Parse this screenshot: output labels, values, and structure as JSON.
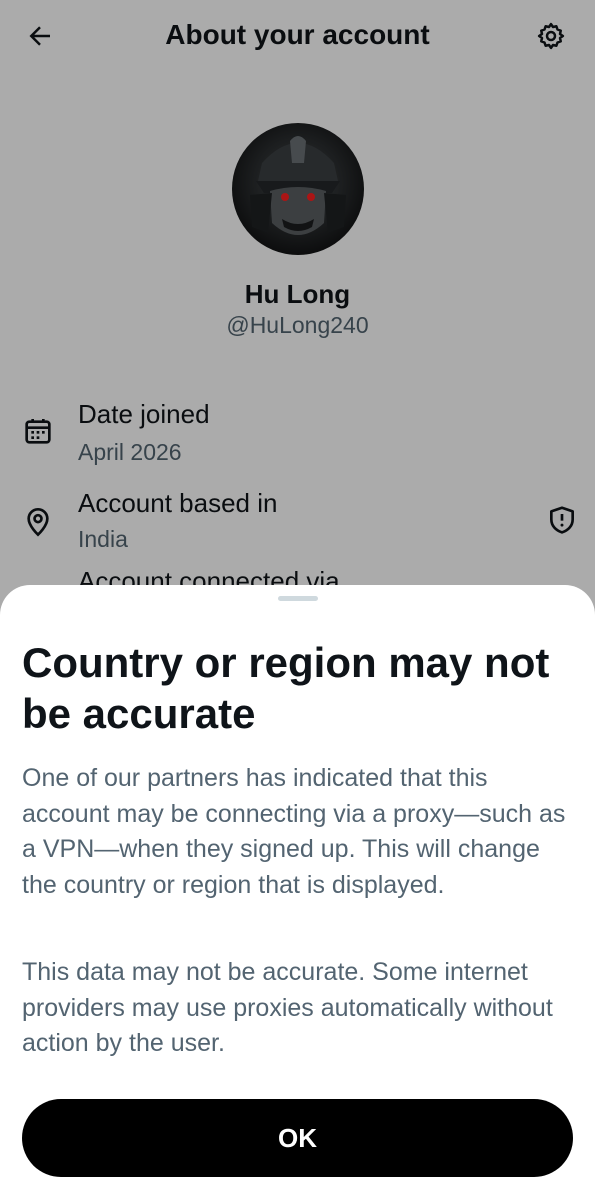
{
  "header": {
    "title": "About your account",
    "back_icon": "arrow-left-icon",
    "settings_icon": "gear-icon"
  },
  "profile": {
    "name": "Hu Long",
    "handle": "@HuLong240",
    "avatar": "samurai-helmet-avatar"
  },
  "info_rows": [
    {
      "label": "Date joined",
      "value": "April 2026",
      "icon": "calendar-icon"
    },
    {
      "label": "Account based in",
      "value": "India",
      "icon": "location-pin-icon",
      "trailing_icon": "shield-alert-icon"
    }
  ],
  "info_row_partial": "Account connected via",
  "sheet": {
    "title": "Country or region may not be accurate",
    "paragraphs": [
      "One of our partners has indicated that this account may be connecting via a proxy—such as a VPN—when they signed up. This will change the country or region that is displayed.",
      "This data may not be accurate. Some internet providers may use proxies automatically without action by the user."
    ],
    "ok_label": "OK"
  },
  "colors": {
    "text_primary": "#0f1419",
    "text_secondary": "#536471",
    "overlay": "rgba(0,0,0,0.33)",
    "button_bg": "#000000",
    "button_text": "#ffffff"
  }
}
